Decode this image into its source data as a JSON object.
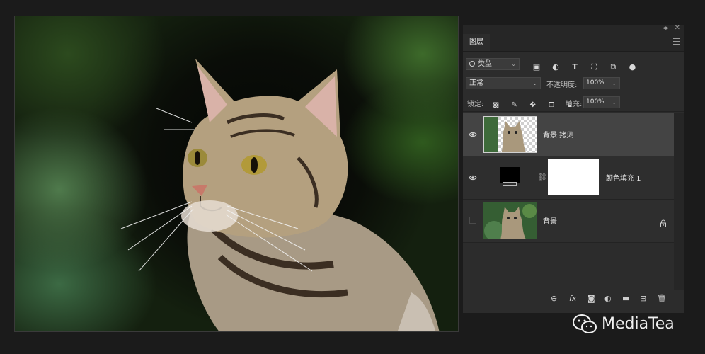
{
  "panel": {
    "tab_label": "图层",
    "filter": {
      "label": "类型"
    },
    "filter_icons": [
      "image-filter-icon",
      "adjustment-filter-icon",
      "text-filter-icon",
      "shape-filter-icon",
      "smart-object-filter-icon",
      "filter-toggle-icon"
    ],
    "blend_mode": "正常",
    "opacity_label": "不透明度:",
    "opacity_value": "100%",
    "lock_label": "锁定:",
    "fill_label": "填充:",
    "fill_value": "100%",
    "layers": [
      {
        "name": "背景 拷贝",
        "visible": true,
        "selected": true
      },
      {
        "name": "颜色填充 1",
        "visible": true,
        "selected": false
      },
      {
        "name": "背景",
        "visible": false,
        "selected": false,
        "locked": true
      }
    ],
    "bottom_tools": [
      "link-layers-icon",
      "fx-icon",
      "mask-icon",
      "adjustment-icon",
      "group-folder-icon",
      "new-layer-icon",
      "trash-icon"
    ],
    "fx_label": "fx"
  },
  "watermark": {
    "text": "MediaTea"
  }
}
